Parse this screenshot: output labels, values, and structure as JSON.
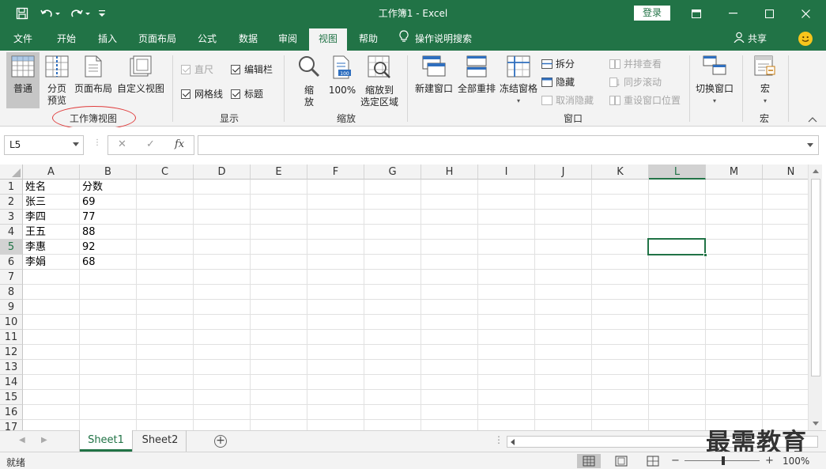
{
  "window": {
    "title": "工作簿1  -  Excel",
    "login_label": "登录"
  },
  "tabs": [
    {
      "label": "文件"
    },
    {
      "label": "开始"
    },
    {
      "label": "插入"
    },
    {
      "label": "页面布局"
    },
    {
      "label": "公式"
    },
    {
      "label": "数据"
    },
    {
      "label": "审阅"
    },
    {
      "label": "视图",
      "active": true
    },
    {
      "label": "帮助"
    }
  ],
  "tell_me": "操作说明搜索",
  "share_label": "共享",
  "ribbon": {
    "workbook_views": {
      "group_label": "工作簿视图",
      "normal": "普通",
      "page_break_1": "分页",
      "page_break_2": "预览",
      "page_layout": "页面布局",
      "custom_views": "自定义视图"
    },
    "show": {
      "group_label": "显示",
      "ruler": {
        "label": "直尺",
        "checked": true,
        "enabled": false
      },
      "formula_bar": {
        "label": "编辑栏",
        "checked": true
      },
      "gridlines": {
        "label": "网格线",
        "checked": true
      },
      "headings": {
        "label": "标题",
        "checked": true
      }
    },
    "zoom": {
      "group_label": "缩放",
      "zoom_1": "缩",
      "zoom_2": "放",
      "zoom100": "100%",
      "zoom_sel_1": "缩放到",
      "zoom_sel_2": "选定区域"
    },
    "window": {
      "group_label": "窗口",
      "new_window": "新建窗口",
      "arrange_all": "全部重排",
      "freeze_panes": "冻结窗格",
      "split": "拆分",
      "hide": "隐藏",
      "unhide": "取消隐藏",
      "side_by_side": "并排查看",
      "sync_scroll": "同步滚动",
      "reset_position": "重设窗口位置",
      "switch_windows": "切换窗口"
    },
    "macros": {
      "group_label": "宏",
      "macros": "宏"
    }
  },
  "formula_bar": {
    "name_box": "L5",
    "fx": "fx",
    "value": ""
  },
  "sheet": {
    "columns": [
      "A",
      "B",
      "C",
      "D",
      "E",
      "F",
      "G",
      "H",
      "I",
      "J",
      "K",
      "L",
      "M",
      "N"
    ],
    "rows": [
      "1",
      "2",
      "3",
      "4",
      "5",
      "6",
      "7",
      "8",
      "9",
      "10",
      "11",
      "12",
      "13",
      "14",
      "15",
      "16",
      "17"
    ],
    "selected_cell": "L5",
    "data": [
      [
        "姓名",
        "分数"
      ],
      [
        "张三",
        "69"
      ],
      [
        "李四",
        "77"
      ],
      [
        "王五",
        "88"
      ],
      [
        "李惠",
        "92"
      ],
      [
        "李娟",
        "68"
      ]
    ]
  },
  "sheet_tabs": [
    {
      "label": "Sheet1",
      "active": true
    },
    {
      "label": "Sheet2",
      "active": false
    }
  ],
  "status": {
    "text": "就绪",
    "zoom": "100%",
    "zoom_percent": 100
  },
  "watermark": "最需教育",
  "colors": {
    "accent": "#217346",
    "annotation": "#e03c3c"
  }
}
